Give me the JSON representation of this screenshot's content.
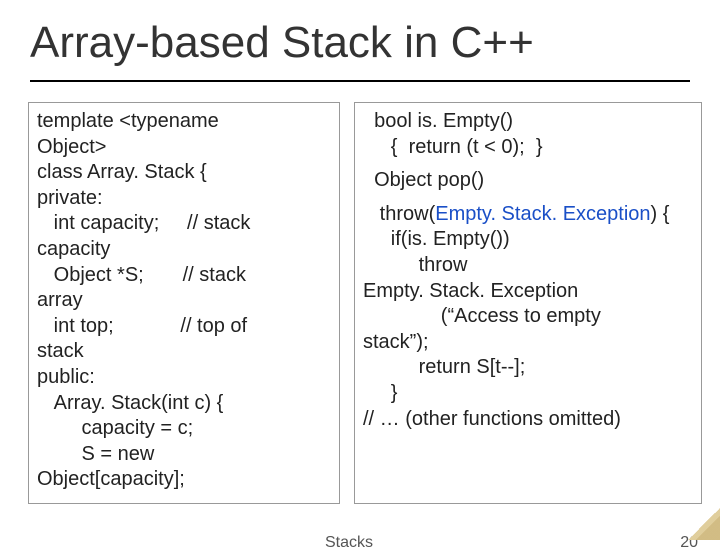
{
  "title": "Array-based Stack in C++",
  "left": {
    "l1": "template <typename",
    "l2": "Object>",
    "l3": "class Array. Stack {",
    "l4": "private:",
    "l5": "   int capacity;     // stack",
    "l6": "capacity",
    "l7": "   Object *S;       // stack",
    "l8": "array",
    "l9": "   int top;            // top of",
    "l10": "stack",
    "l11": "public:",
    "l12": "   Array. Stack(int c) {",
    "l13": "        capacity = c;",
    "l14": "        S = new",
    "l15": "Object[capacity];"
  },
  "right": {
    "l1": "  bool is. Empty()",
    "l2": "     {  return (t < 0);  }",
    "l3": "  Object pop()",
    "l4a": "   throw(",
    "l4b": "Empty. Stack. Exception",
    "l4c": ") {",
    "l5": "     if(is. Empty())",
    "l6": "          throw",
    "l7": "Empty. Stack. Exception",
    "l8": "              (“Access to empty",
    "l9": "stack”);",
    "l10": "          return S[t--];",
    "l11": "     }",
    "l12": "// … (other functions omitted)"
  },
  "footer": {
    "label": "Stacks",
    "page": "20"
  }
}
